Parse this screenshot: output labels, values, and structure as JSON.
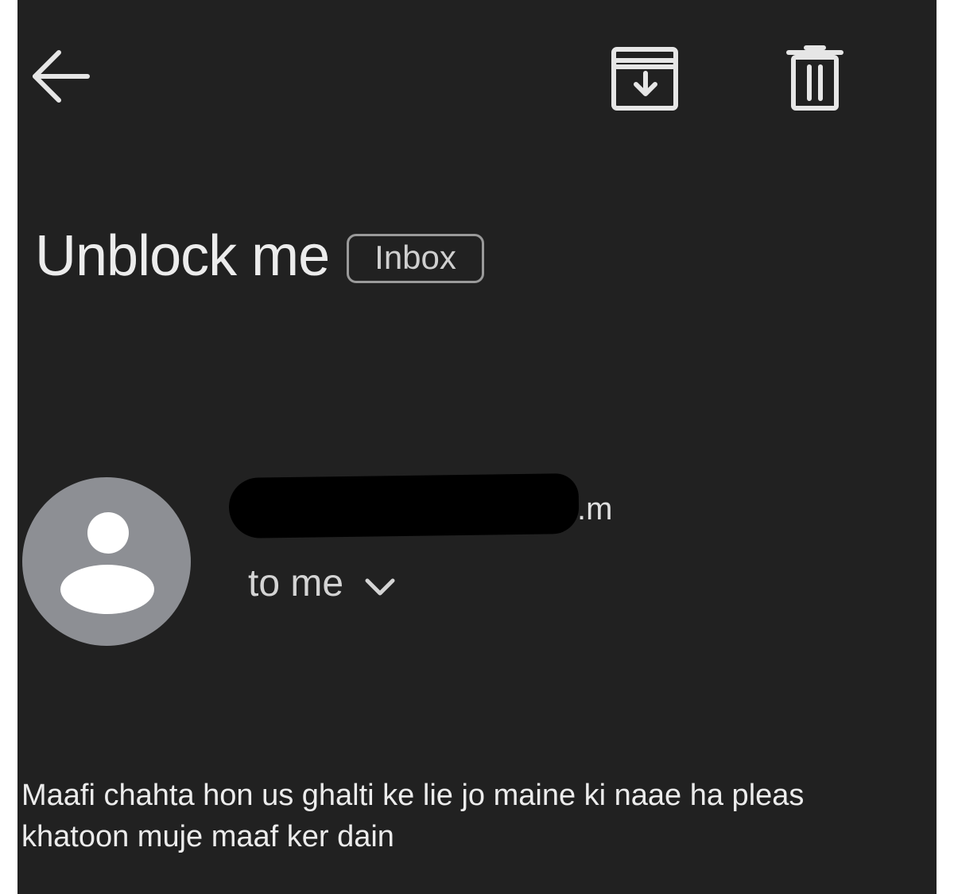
{
  "toolbar": {
    "back_icon": "arrow-left-icon",
    "archive_icon": "archive-icon",
    "delete_icon": "trash-icon"
  },
  "message": {
    "subject": "Unblock me",
    "label": "Inbox",
    "sender_suffix": ".m",
    "recipient": "to me",
    "body_lines": [
      "Maafi chahta hon us ghalti ke lie jo maine ki naae ha pleas",
      "khatoon muje maaf ker dain"
    ]
  },
  "colors": {
    "background": "#212121",
    "avatar": "#8d8f94",
    "text": "#ececec"
  }
}
